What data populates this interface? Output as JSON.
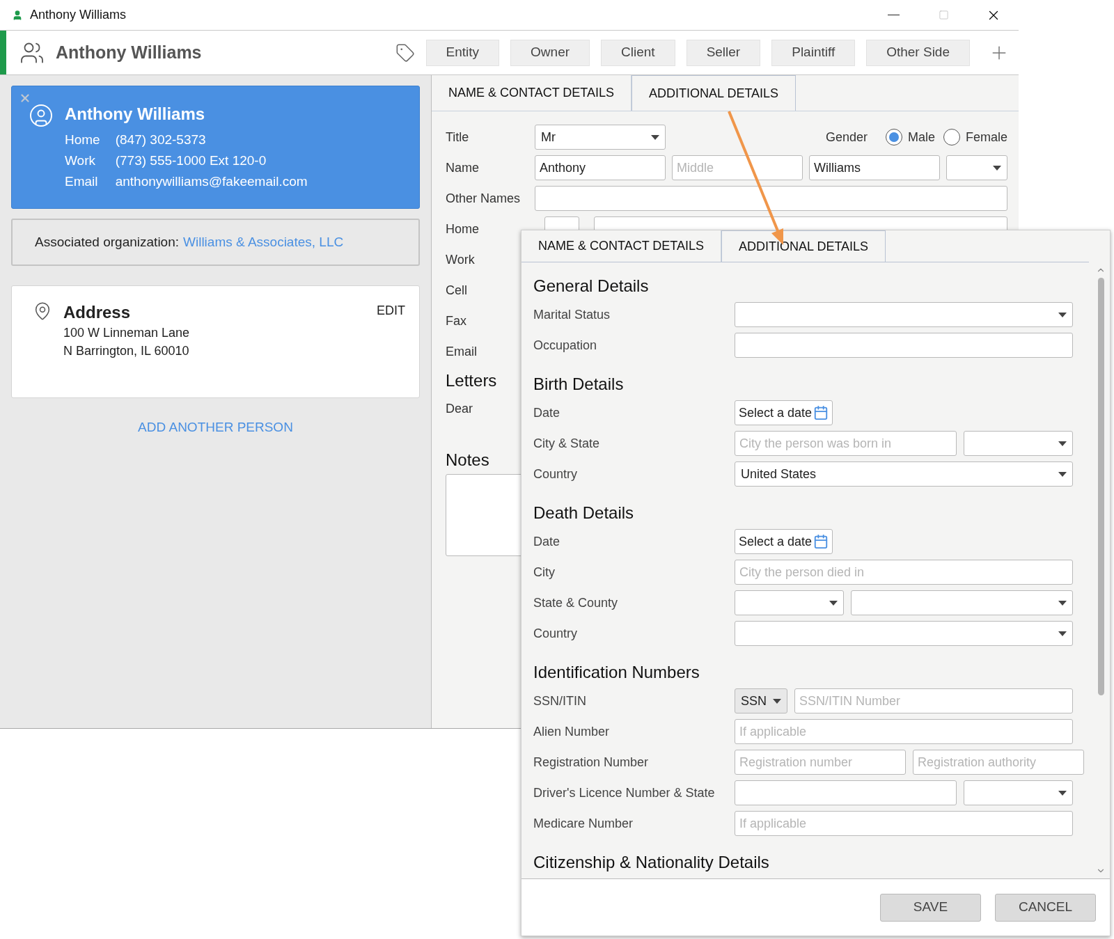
{
  "window": {
    "title": "Anthony Williams"
  },
  "header": {
    "name": "Anthony Williams",
    "roles": [
      "Entity",
      "Owner",
      "Client",
      "Seller",
      "Plaintiff",
      "Other Side"
    ]
  },
  "contact_card": {
    "name": "Anthony Williams",
    "rows": [
      {
        "label": "Home",
        "value": "(847) 302-5373"
      },
      {
        "label": "Work",
        "value": "(773) 555-1000 Ext 120-0"
      },
      {
        "label": "Email",
        "value": "anthonywilliams@fakeemail.com"
      }
    ]
  },
  "association": {
    "label": "Associated organization:",
    "link": "Williams & Associates, LLC"
  },
  "address": {
    "title": "Address",
    "edit": "EDIT",
    "lines": [
      "100 W Linneman Lane",
      "N Barrington, IL 60010"
    ]
  },
  "add_person": "ADD ANOTHER PERSON",
  "form": {
    "tabs": [
      {
        "label": "NAME & CONTACT DETAILS",
        "selected": false
      },
      {
        "label": "ADDITIONAL DETAILS",
        "selected": true
      }
    ],
    "title_label": "Title",
    "title_value": "Mr",
    "gender": {
      "label": "Gender",
      "options": [
        {
          "label": "Male",
          "selected": true
        },
        {
          "label": "Female",
          "selected": false
        }
      ]
    },
    "name_label": "Name",
    "first": "Anthony",
    "middle_placeholder": "Middle",
    "last": "Williams",
    "other_names_label": "Other Names",
    "home_label": "Home",
    "labels": [
      "Work",
      "Cell",
      "Fax",
      "Email"
    ],
    "letters": "Letters",
    "dear": "Dear",
    "notes": "Notes"
  },
  "popup": {
    "tabs": [
      {
        "label": "NAME & CONTACT DETAILS",
        "selected": false
      },
      {
        "label": "ADDITIONAL DETAILS",
        "selected": true
      }
    ],
    "sections": [
      {
        "title": "General Details",
        "rows": [
          {
            "label": "Marital Status",
            "controls": [
              {
                "kind": "select"
              }
            ]
          },
          {
            "label": "Occupation",
            "controls": [
              {
                "kind": "text"
              }
            ]
          }
        ]
      },
      {
        "title": "Birth Details",
        "rows": [
          {
            "label": "Date",
            "controls": [
              {
                "kind": "date",
                "text": "Select a date"
              }
            ]
          },
          {
            "label": "City & State",
            "controls": [
              {
                "kind": "text",
                "placeholder": "City the person was born in"
              },
              {
                "kind": "short-select"
              }
            ]
          },
          {
            "label": "Country",
            "controls": [
              {
                "kind": "select",
                "value": "United States"
              }
            ]
          }
        ]
      },
      {
        "title": "Death Details",
        "rows": [
          {
            "label": "Date",
            "controls": [
              {
                "kind": "date",
                "text": "Select a date"
              }
            ]
          },
          {
            "label": "City",
            "controls": [
              {
                "kind": "text",
                "placeholder": "City the person died in"
              }
            ]
          },
          {
            "label": "State & County",
            "controls": [
              {
                "kind": "short-select"
              },
              {
                "kind": "select"
              }
            ]
          },
          {
            "label": "Country",
            "controls": [
              {
                "kind": "select"
              }
            ]
          }
        ]
      },
      {
        "title": "Identification Numbers",
        "rows": [
          {
            "label": "SSN/ITIN",
            "controls": [
              {
                "kind": "prefix-select",
                "value": "SSN"
              },
              {
                "kind": "text",
                "placeholder": "SSN/ITIN Number"
              }
            ]
          },
          {
            "label": "Alien Number",
            "controls": [
              {
                "kind": "text",
                "placeholder": "If applicable"
              }
            ]
          },
          {
            "label": "Registration Number",
            "controls": [
              {
                "kind": "text",
                "placeholder": "Registration number"
              },
              {
                "kind": "text",
                "placeholder": "Registration authority"
              }
            ]
          },
          {
            "label": "Driver's Licence Number & State",
            "controls": [
              {
                "kind": "text"
              },
              {
                "kind": "short-select"
              }
            ]
          },
          {
            "label": "Medicare Number",
            "controls": [
              {
                "kind": "text",
                "placeholder": "If applicable"
              }
            ]
          }
        ]
      },
      {
        "title": "Citizenship & Nationality Details"
      }
    ],
    "buttons": [
      "SAVE",
      "CANCEL"
    ]
  }
}
